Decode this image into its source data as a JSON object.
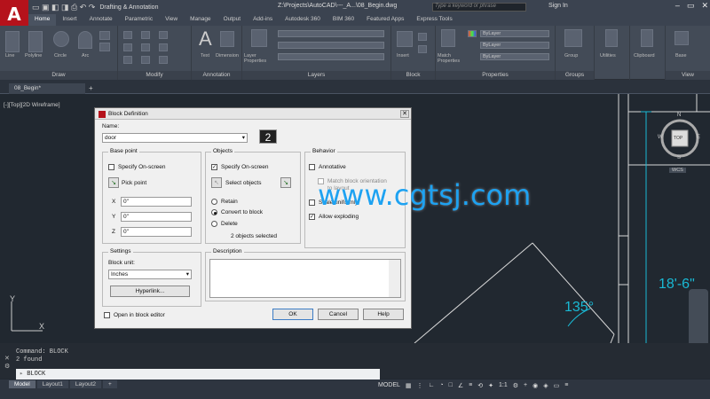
{
  "titlebar": {
    "logo": "A",
    "workspace": "Drafting & Annotation",
    "file_title": "Z:\\Projects\\AutoCAD\\---_A...\\08_Begin.dwg",
    "search_placeholder": "Type a keyword or phrase",
    "sign_in": "Sign In"
  },
  "ribbon_tabs": [
    "Home",
    "Insert",
    "Annotate",
    "Parametric",
    "View",
    "Manage",
    "Output",
    "Add-ins",
    "Autodesk 360",
    "BIM 360",
    "Featured Apps",
    "Express Tools"
  ],
  "ribbon_panels": [
    "Draw",
    "Modify",
    "Annotation",
    "Layers",
    "Block",
    "Properties",
    "Groups",
    "View"
  ],
  "ribbon_tools": {
    "line": "Line",
    "polyline": "Polyline",
    "circle": "Circle",
    "arc": "Arc",
    "text": "Text",
    "dimension": "Dimension",
    "layer_properties": "Layer Properties",
    "insert": "Insert",
    "match_properties": "Match Properties",
    "group": "Group",
    "utilities": "Utilities",
    "clipboard": "Clipboard",
    "base": "Base",
    "bylayer": "ByLayer"
  },
  "doc_tab": "08_Begin*",
  "viewport_label": "[-][Top][2D Wireframe]",
  "viewcube": {
    "n": "N",
    "s": "S",
    "e": "E",
    "w": "W",
    "top": "TOP",
    "wcs": "WCS"
  },
  "dims": {
    "d1": "18'-6\"",
    "d2": "135°"
  },
  "ucs": {
    "x": "X",
    "y": "Y"
  },
  "command_history": [
    "Command: BLOCK",
    "2 found"
  ],
  "command_line": "BLOCK",
  "layout_tabs": [
    "Model",
    "Layout1",
    "Layout2"
  ],
  "status": {
    "model": "MODEL",
    "scale": "1:1"
  },
  "watermark": "www.cgtsj.com",
  "dialog": {
    "title": "Block Definition",
    "name_label": "Name:",
    "name_value": "door",
    "base_point": {
      "label": "Base point",
      "specify": "Specify On-screen",
      "pick": "Pick point",
      "x": "0\"",
      "y": "0\"",
      "z": "0\""
    },
    "objects": {
      "label": "Objects",
      "specify": "Specify On-screen",
      "select": "Select objects",
      "retain": "Retain",
      "convert": "Convert to block",
      "delete": "Delete",
      "count": "2 objects selected"
    },
    "behavior": {
      "label": "Behavior",
      "annotative": "Annotative",
      "match": "Match block orientation to layout",
      "scale": "Scale uniformly",
      "explode": "Allow exploding"
    },
    "settings": {
      "label": "Settings",
      "unit_label": "Block unit:",
      "unit": "Inches",
      "hyperlink": "Hyperlink..."
    },
    "description": "Description",
    "open_editor": "Open in block editor",
    "ok": "OK",
    "cancel": "Cancel",
    "help": "Help"
  }
}
